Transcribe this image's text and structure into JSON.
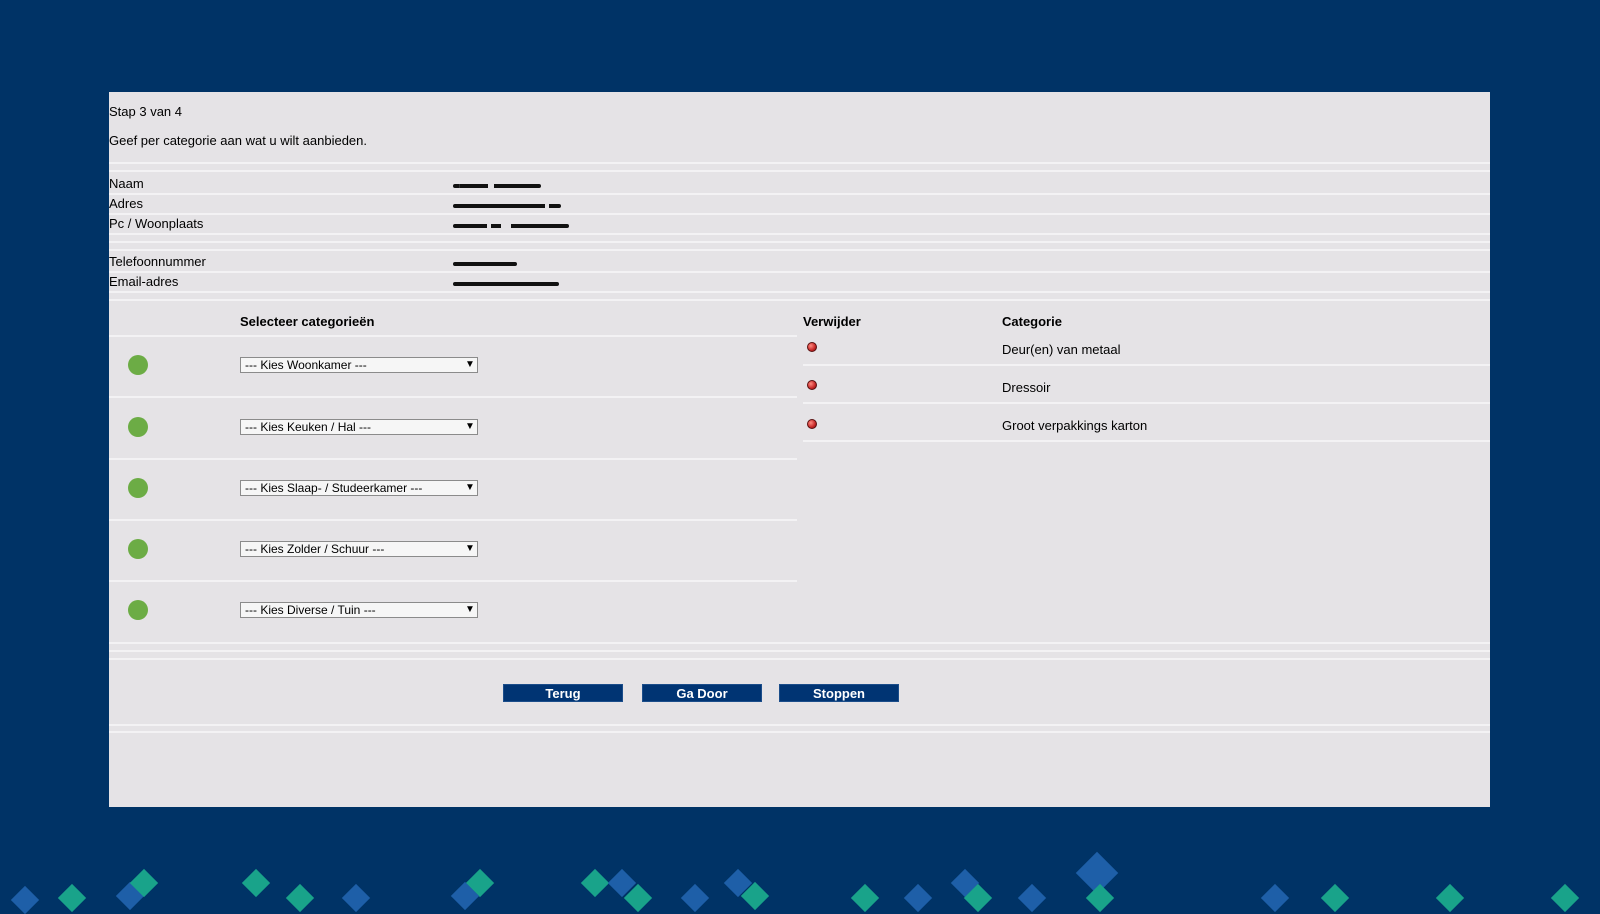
{
  "header": {
    "step": "Stap 3 van 4",
    "instruction": "Geef per categorie aan wat u wilt aanbieden."
  },
  "info": {
    "name_label": "Naam",
    "address_label": "Adres",
    "postcode_label": "Pc / Woonplaats",
    "phone_label": "Telefoonnummer",
    "email_label": "Email-adres"
  },
  "categories": {
    "header": "Selecteer categorieën",
    "woonkamer": "--- Kies Woonkamer ---",
    "keuken": "--- Kies Keuken / Hal ---",
    "slaapkamer": "--- Kies Slaap- / Studeerkamer ---",
    "zolder": "--- Kies Zolder / Schuur ---",
    "diverse": "--- Kies Diverse / Tuin ---"
  },
  "selected": {
    "remove_header": "Verwijder",
    "category_header": "Categorie",
    "items": [
      "Deur(en) van metaal",
      "Dressoir",
      "Groot verpakkings karton"
    ]
  },
  "buttons": {
    "back": "Terug",
    "continue": "Ga Door",
    "stop": "Stoppen"
  },
  "colors": {
    "background": "#003366",
    "panel": "#e5e3e6",
    "button": "#003473",
    "add_dot": "#6cac45",
    "remove_dot": "#c62828"
  }
}
